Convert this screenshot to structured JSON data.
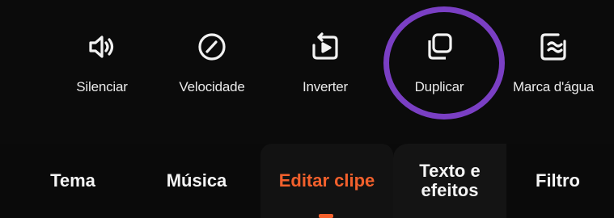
{
  "toolbar": {
    "items": [
      {
        "label": "Silenciar",
        "icon": "speaker-icon"
      },
      {
        "label": "Velocidade",
        "icon": "speedometer-icon"
      },
      {
        "label": "Inverter",
        "icon": "reverse-play-icon"
      },
      {
        "label": "Duplicar",
        "icon": "duplicate-icon"
      },
      {
        "label": "Marca d'água",
        "icon": "watermark-icon"
      }
    ]
  },
  "highlight": {
    "color": "#7a3fc4"
  },
  "tabs": {
    "items": [
      {
        "label": "Tema"
      },
      {
        "label": "Música"
      },
      {
        "label": "Editar clipe",
        "active": true
      },
      {
        "label_line1": "Texto e",
        "label_line2": "efeitos"
      },
      {
        "label": "Filtro"
      }
    ],
    "active_color": "#f2602c"
  }
}
